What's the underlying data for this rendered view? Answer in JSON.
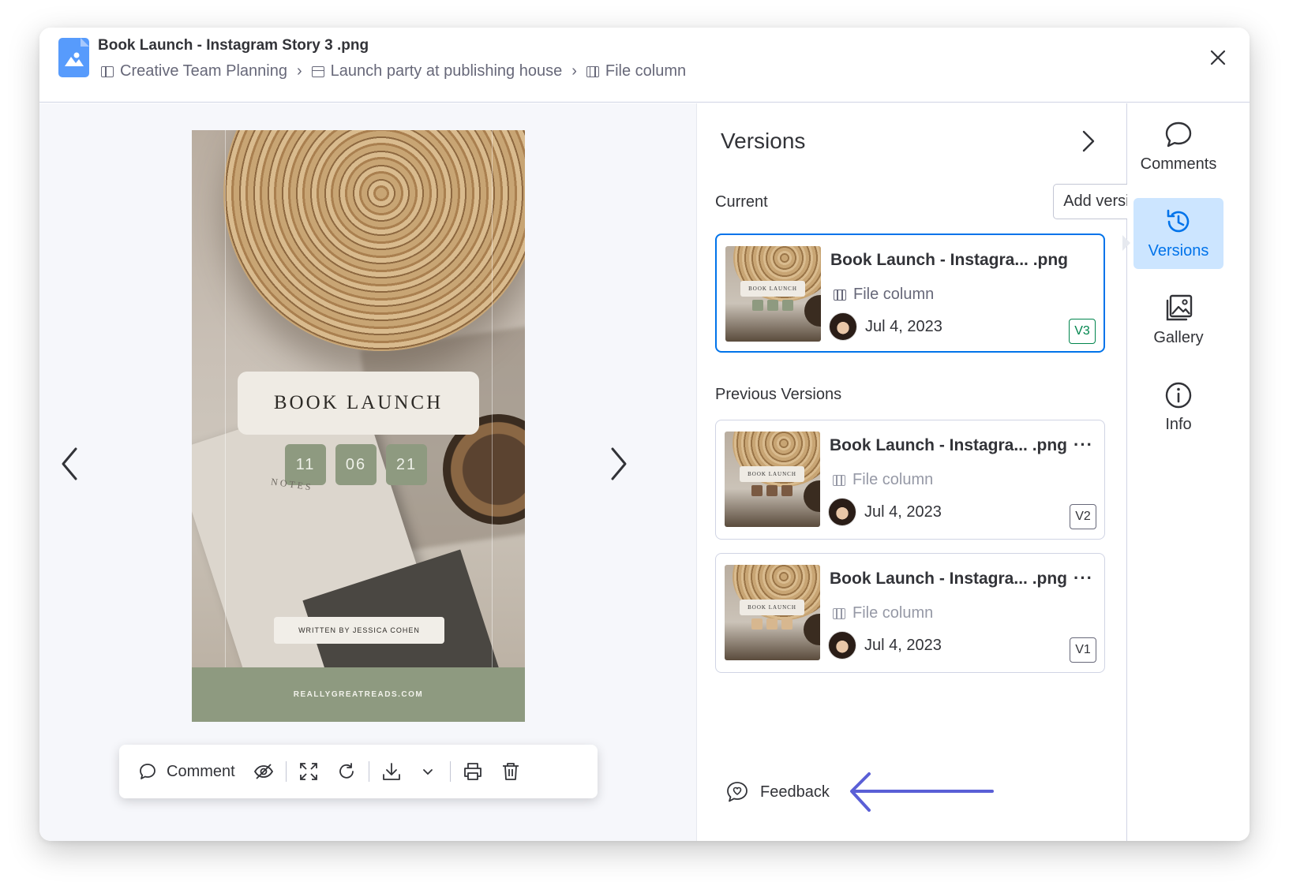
{
  "header": {
    "title": "Book Launch - Instagram Story 3 .png",
    "breadcrumb": [
      {
        "label": "Creative Team Planning",
        "icon": "board-icon"
      },
      {
        "label": "Launch party at publishing house",
        "icon": "item-icon"
      },
      {
        "label": "File column",
        "icon": "file-column-icon"
      }
    ]
  },
  "preview": {
    "story": {
      "title": "BOOK LAUNCH",
      "dates": [
        "11",
        "06",
        "21"
      ],
      "notes": "NOTES",
      "author": "WRITTEN BY JESSICA COHEN",
      "footer": "REALLYGREATREADS.COM"
    },
    "toolbar": {
      "comment_label": "Comment"
    }
  },
  "versions": {
    "title": "Versions",
    "current_label": "Current",
    "add_version_label": "Add version",
    "previous_label": "Previous Versions",
    "current": {
      "name": "Book Launch - Instagra... .png",
      "column": "File column",
      "date": "Jul 4, 2023",
      "badge": "V3"
    },
    "previous": [
      {
        "name": "Book Launch - Instagra... .png",
        "column": "File column",
        "date": "Jul 4, 2023",
        "badge": "V2",
        "menu": "···"
      },
      {
        "name": "Book Launch - Instagra... .png",
        "column": "File column",
        "date": "Jul 4, 2023",
        "badge": "V1",
        "menu": "···"
      }
    ],
    "thumb_card_text": "BOOK LAUNCH",
    "feedback_label": "Feedback"
  },
  "rail": {
    "items": [
      {
        "label": "Comments",
        "icon": "comment-icon"
      },
      {
        "label": "Versions",
        "icon": "history-icon",
        "active": true
      },
      {
        "label": "Gallery",
        "icon": "gallery-icon"
      },
      {
        "label": "Info",
        "icon": "info-icon"
      }
    ]
  },
  "colors": {
    "accent": "#0073ea",
    "active_bg": "#cce5ff",
    "current_badge": "#00854d",
    "annotation_arrow": "#5a5fd6",
    "story_green": "#8e9a80"
  }
}
